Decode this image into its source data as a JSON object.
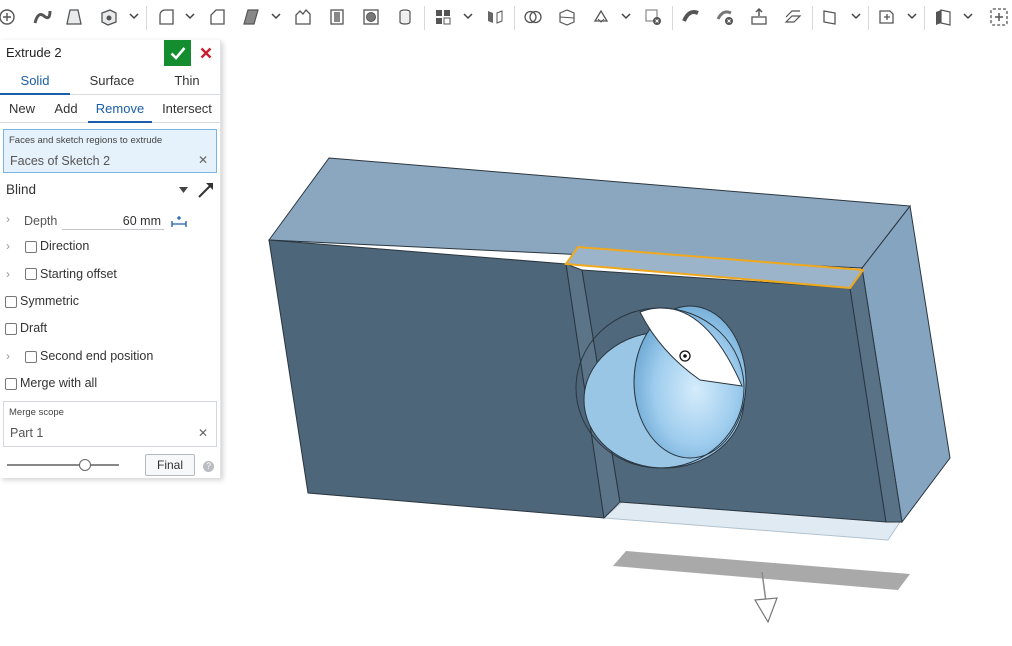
{
  "colors": {
    "accent": "#1a5fa8",
    "confirm": "#138d2d",
    "cancel": "#c8202f",
    "selection_fill": "#e5f1fb",
    "edge_highlight": "#f0a81c",
    "model_front": "#4e6679",
    "model_top": "#8aa7bf"
  },
  "toolbar": {
    "icons": [
      "sketch-icon",
      "sweep-icon",
      "loft-icon",
      "revolve-icon",
      "fillet-icon",
      "chamfer-icon",
      "draft-icon",
      "rib-icon",
      "shell-icon",
      "hole-icon",
      "cylinder-icon",
      "pattern-icon",
      "mirror-icon",
      "boolean-icon",
      "split-icon",
      "transform-icon",
      "delete-part-icon",
      "thicken-icon",
      "replace-face-icon",
      "move-face-icon",
      "offset-surface-icon",
      "plane-icon",
      "mate-connector-icon",
      "sheet-metal-icon",
      "add-custom-feature-icon"
    ]
  },
  "panel": {
    "title": "Extrude 2",
    "tabs": [
      "Solid",
      "Surface",
      "Thin"
    ],
    "active_tab": "Solid",
    "ops": [
      "New",
      "Add",
      "Remove",
      "Intersect"
    ],
    "active_op": "Remove",
    "faces_label": "Faces and sketch regions to extrude",
    "faces_value": "Faces of Sketch 2",
    "end_type": "Blind",
    "depth_label": "Depth",
    "depth_value": "60 mm",
    "direction_label": "Direction",
    "starting_offset_label": "Starting offset",
    "symmetric_label": "Symmetric",
    "draft_label": "Draft",
    "second_end_label": "Second end position",
    "merge_all_label": "Merge with all",
    "merge_scope_label": "Merge scope",
    "merge_scope_value": "Part 1",
    "final_label": "Final",
    "help_label": "?",
    "slider_fraction": 0.7
  }
}
